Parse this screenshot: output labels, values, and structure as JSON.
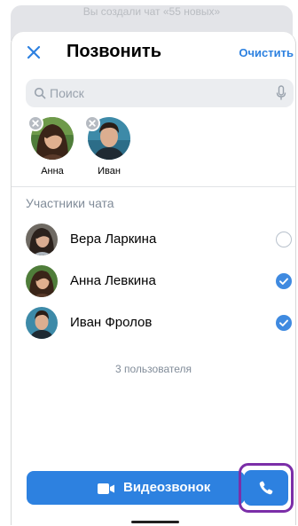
{
  "background_banner": {
    "text": "Вы создали чат «55 новых»"
  },
  "header": {
    "close_icon": "close-icon",
    "title": "Позвонить",
    "clear_label": "Очистить"
  },
  "search": {
    "placeholder": "Поиск",
    "search_icon": "search-icon",
    "mic_icon": "mic-icon"
  },
  "selected": [
    {
      "name": "Анна"
    },
    {
      "name": "Иван"
    }
  ],
  "section_title": "Участники чата",
  "members": [
    {
      "name": "Вера Ларкина",
      "checked": false
    },
    {
      "name": "Анна Левкина",
      "checked": true
    },
    {
      "name": "Иван Фролов",
      "checked": true
    }
  ],
  "count_text": "3 пользователя",
  "actions": {
    "video_label": "Видеозвонок",
    "video_icon": "video-camera-icon",
    "call_icon": "phone-icon"
  },
  "colors": {
    "accent": "#2d81e0",
    "highlight_frame": "#7b2ea8",
    "secondary_text": "#818c99"
  }
}
